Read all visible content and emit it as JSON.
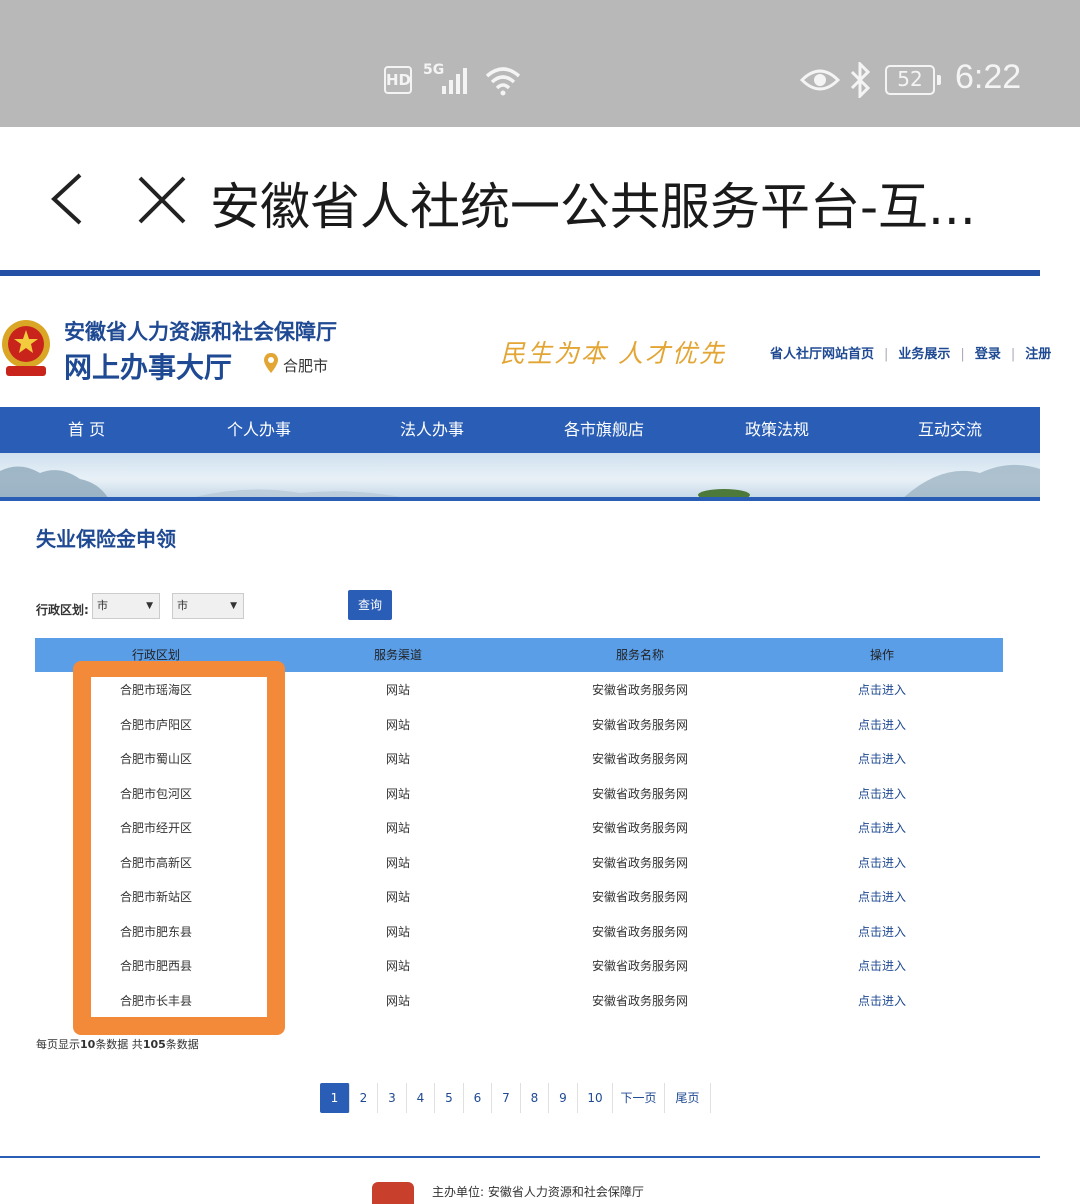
{
  "status_bar": {
    "hd": "HD",
    "network": "5G",
    "battery": "52",
    "time": "6:22"
  },
  "browser": {
    "title": "安徽省人社统一公共服务平台-互..."
  },
  "header": {
    "org_name": "安徽省人力资源和社会保障厅",
    "hall_name": "网上办事大厅",
    "city": "合肥市",
    "slogan": "民生为本  人才优先",
    "links": [
      "省人社厅网站首页",
      "业务展示",
      "登录",
      "注册"
    ]
  },
  "nav": [
    "首 页",
    "个人办事",
    "法人办事",
    "各市旗舰店",
    "政策法规",
    "互动交流"
  ],
  "page_heading": "失业保险金申领",
  "filter": {
    "label": "行政区划:",
    "select1": "市",
    "select2": "市",
    "query_label": "查询"
  },
  "table": {
    "headers": [
      "行政区划",
      "服务渠道",
      "服务名称",
      "操作"
    ],
    "rows": [
      [
        "合肥市瑶海区",
        "网站",
        "安徽省政务服务网",
        "点击进入"
      ],
      [
        "合肥市庐阳区",
        "网站",
        "安徽省政务服务网",
        "点击进入"
      ],
      [
        "合肥市蜀山区",
        "网站",
        "安徽省政务服务网",
        "点击进入"
      ],
      [
        "合肥市包河区",
        "网站",
        "安徽省政务服务网",
        "点击进入"
      ],
      [
        "合肥市经开区",
        "网站",
        "安徽省政务服务网",
        "点击进入"
      ],
      [
        "合肥市高新区",
        "网站",
        "安徽省政务服务网",
        "点击进入"
      ],
      [
        "合肥市新站区",
        "网站",
        "安徽省政务服务网",
        "点击进入"
      ],
      [
        "合肥市肥东县",
        "网站",
        "安徽省政务服务网",
        "点击进入"
      ],
      [
        "合肥市肥西县",
        "网站",
        "安徽省政务服务网",
        "点击进入"
      ],
      [
        "合肥市长丰县",
        "网站",
        "安徽省政务服务网",
        "点击进入"
      ]
    ]
  },
  "summary": {
    "prefix": "每页显示",
    "per_page": "10",
    "mid": "条数据  共",
    "total": "105",
    "suffix": "条数据"
  },
  "pager": [
    "1",
    "2",
    "3",
    "4",
    "5",
    "6",
    "7",
    "8",
    "9",
    "10",
    "下一页",
    "尾页"
  ],
  "footer": {
    "sponsor": "主办单位:  安徽省人力资源和社会保障厅"
  },
  "colors": {
    "brand_blue": "#2a5db5",
    "table_header": "#5b9ee8",
    "highlight": "#f28a3a",
    "slogan_gold": "#e3a534"
  }
}
